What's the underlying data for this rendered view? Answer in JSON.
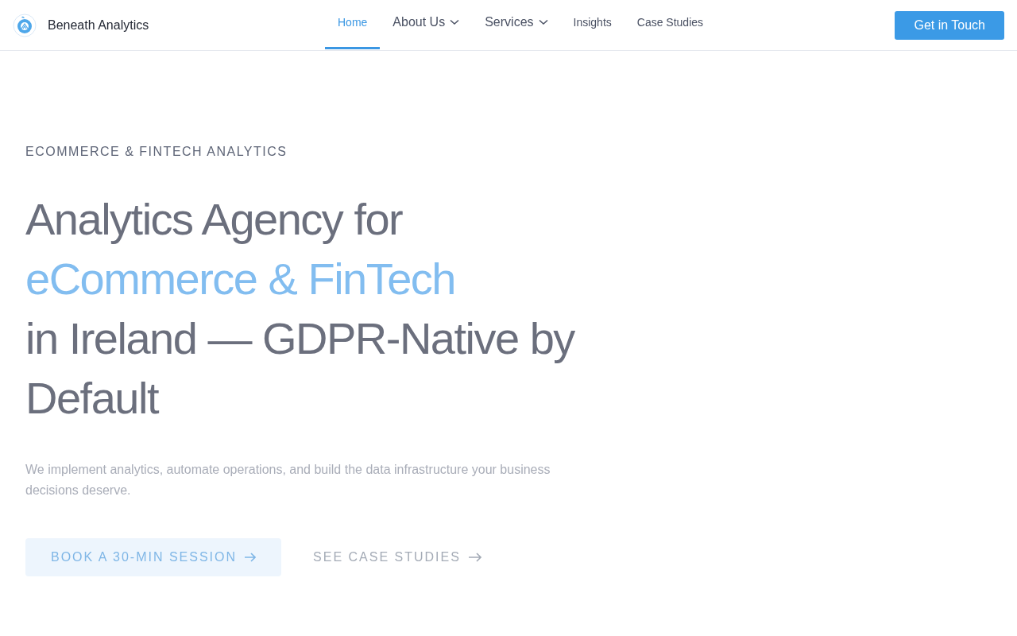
{
  "brand": {
    "name": "Beneath Analytics"
  },
  "nav": [
    {
      "label": "Home",
      "selected": true,
      "dropdown": false
    },
    {
      "label": "About Us",
      "selected": false,
      "dropdown": true
    },
    {
      "label": "Services",
      "selected": false,
      "dropdown": true
    },
    {
      "label": "Insights",
      "selected": false,
      "dropdown": false
    },
    {
      "label": "Case Studies",
      "selected": false,
      "dropdown": false
    }
  ],
  "cta": "Get in Touch",
  "hero": {
    "eyebrow": "ECOMMERCE & FINTECH ANALYTICS",
    "headline": [
      {
        "text": "Analytics Agency for",
        "highlight": false
      },
      {
        "text": "eCommerce & FinTech",
        "highlight": true
      },
      {
        "text": "in Ireland — GDPR-Native by Default",
        "highlight": false
      }
    ],
    "lead": "We implement analytics, automate operations, and build the data infrastructure your business decisions deserve.",
    "buttons": [
      {
        "label": "BOOK A 30-MIN SESSION",
        "kind": "primary"
      },
      {
        "label": "SEE CASE STUDIES",
        "kind": "link"
      }
    ]
  }
}
